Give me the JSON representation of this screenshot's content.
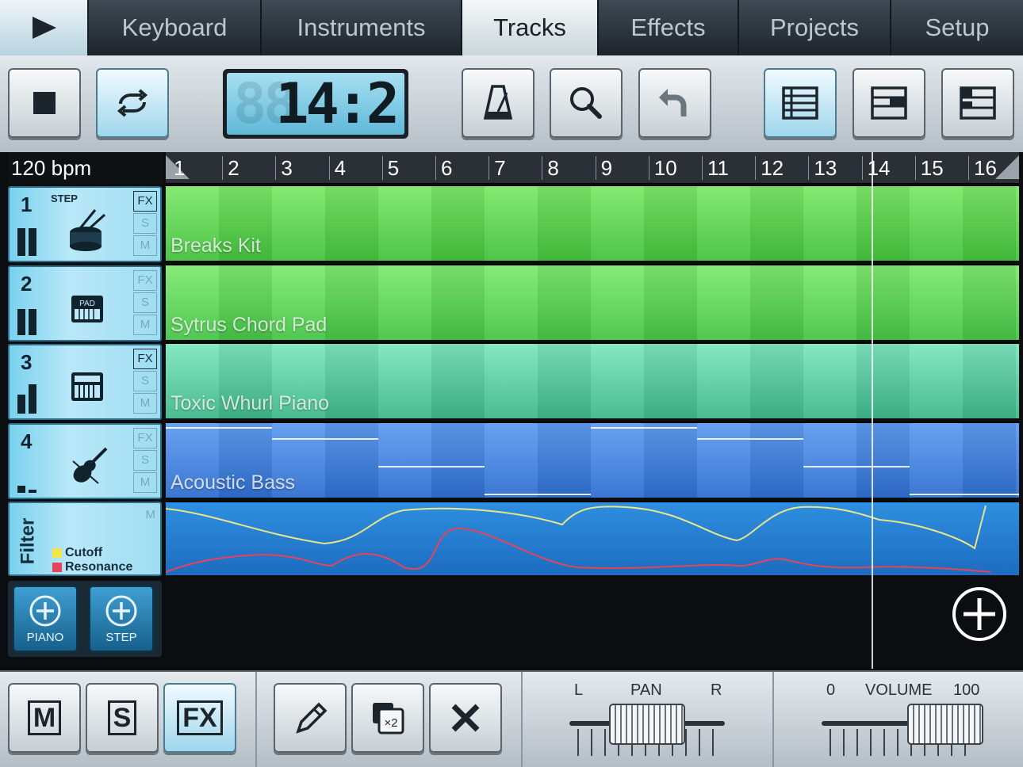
{
  "tabs": [
    {
      "label": "Keyboard",
      "active": false
    },
    {
      "label": "Instruments",
      "active": false
    },
    {
      "label": "Tracks",
      "active": true
    },
    {
      "label": "Effects",
      "active": false
    },
    {
      "label": "Projects",
      "active": false
    },
    {
      "label": "Setup",
      "active": false
    }
  ],
  "transport": {
    "position_ghost": "88",
    "position": "14:2",
    "icons": [
      "stop-icon",
      "loop-icon",
      "metronome-icon",
      "zoom-icon",
      "undo-icon",
      "view-grid-icon",
      "view-split-icon",
      "view-piano-icon"
    ]
  },
  "tempo": {
    "label": "120 bpm"
  },
  "ruler": {
    "bars": [
      "1",
      "2",
      "3",
      "4",
      "5",
      "6",
      "7",
      "8",
      "9",
      "10",
      "11",
      "12",
      "13",
      "14",
      "15",
      "16"
    ]
  },
  "tracks": [
    {
      "number": "1",
      "name": "Breaks Kit",
      "icon": "drum-icon",
      "tag": "STEP",
      "fx_label": "FX",
      "s_label": "S",
      "m_label": "M",
      "color": "#43c23d",
      "color_hi": "#7ee86a",
      "meter": [
        0.8,
        0.8
      ]
    },
    {
      "number": "2",
      "name": "Sytrus Chord Pad",
      "icon": "keyboard-pad-icon",
      "tag": "",
      "fx_label": "FX",
      "s_label": "S",
      "m_label": "M",
      "color": "#45c447",
      "color_hi": "#80ea70",
      "meter": [
        0.75,
        0.75
      ]
    },
    {
      "number": "3",
      "name": "Toxic Whurl Piano",
      "icon": "piano-icon",
      "tag": "",
      "fx_label": "FX",
      "s_label": "S",
      "m_label": "M",
      "color": "#3fb78d",
      "color_hi": "#7ee6c0",
      "meter": [
        0.55,
        0.85
      ]
    },
    {
      "number": "4",
      "name": "Acoustic Bass",
      "icon": "violin-icon",
      "tag": "",
      "fx_label": "FX",
      "s_label": "S",
      "m_label": "M",
      "color": "#2f6fd0",
      "color_hi": "#5f9cf0",
      "meter": [
        0.2,
        0.1
      ]
    }
  ],
  "automation": {
    "title": "Filter",
    "m_label": "M",
    "legend": [
      {
        "label": "Cutoff",
        "color": "#f2e64a"
      },
      {
        "label": "Resonance",
        "color": "#e8435a"
      }
    ]
  },
  "add_buttons": [
    {
      "label": "PIANO",
      "icon": "add-icon"
    },
    {
      "label": "STEP",
      "icon": "add-icon"
    }
  ],
  "bottom": {
    "mute": "M",
    "solo": "S",
    "fx": "FX",
    "duplicate_label": "×2",
    "pan": {
      "label": "PAN",
      "left": "L",
      "right": "R",
      "value": 0.5
    },
    "volume": {
      "label": "VOLUME",
      "min": "0",
      "max": "100",
      "value": 0.78
    }
  }
}
